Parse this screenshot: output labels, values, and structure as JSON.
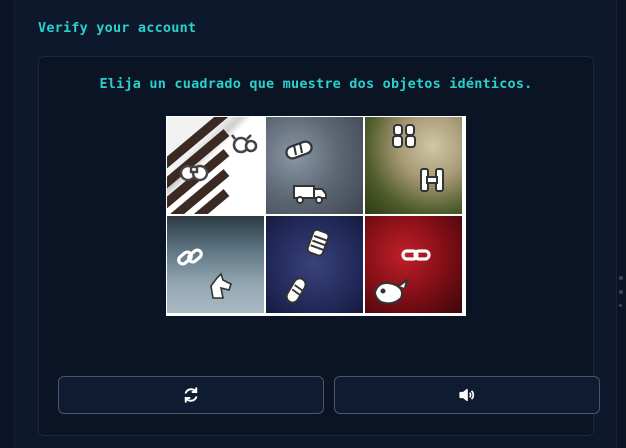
{
  "header": {
    "title": "Verify your account"
  },
  "challenge": {
    "instruction": "Elija un cuadrado que muestre dos objetos idénticos.",
    "tiles": [
      {
        "background": "zebra stripes",
        "icons": [
          "binoculars-icon",
          "bull-icon"
        ]
      },
      {
        "background": "grey stone",
        "icons": [
          "bread-roll-icon",
          "truck-icon"
        ]
      },
      {
        "background": "lizard eye",
        "icons": [
          "binoculars-icon",
          "binoculars-icon"
        ]
      },
      {
        "background": "tree sky",
        "icons": [
          "link-chain-icon",
          "horse-icon"
        ]
      },
      {
        "background": "starry sky",
        "icons": [
          "bread-roll-icon",
          "bread-roll-icon"
        ]
      },
      {
        "background": "red texture",
        "icons": [
          "link-chain-icon",
          "whale-icon"
        ]
      }
    ]
  },
  "buttons": {
    "refresh": "refresh-icon",
    "audio": "speaker-icon"
  },
  "colors": {
    "accent": "#2ad1cc",
    "page_bg": "#0b1324",
    "card_bg": "#0b1424",
    "button_border": "#4a5566"
  }
}
